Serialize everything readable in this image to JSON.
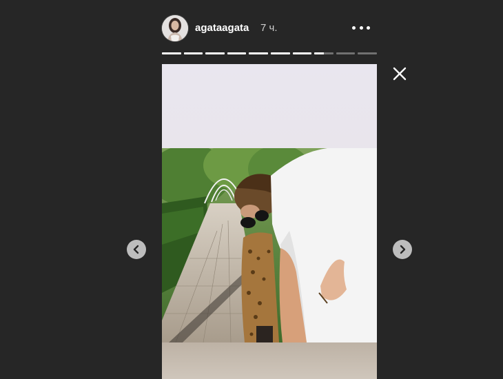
{
  "header": {
    "username": "agataagata",
    "timestamp": "7 ч."
  },
  "progress": {
    "segments": 10,
    "current_index": 7,
    "current_progress": 0.5
  },
  "icons": {
    "more": "more-horizontal-icon",
    "close": "close-icon",
    "prev": "chevron-left-icon",
    "next": "chevron-right-icon"
  },
  "colors": {
    "background": "#262626",
    "text": "#ffffff",
    "progress_active": "#ffffff",
    "nav_button": "#bdbdbd"
  }
}
